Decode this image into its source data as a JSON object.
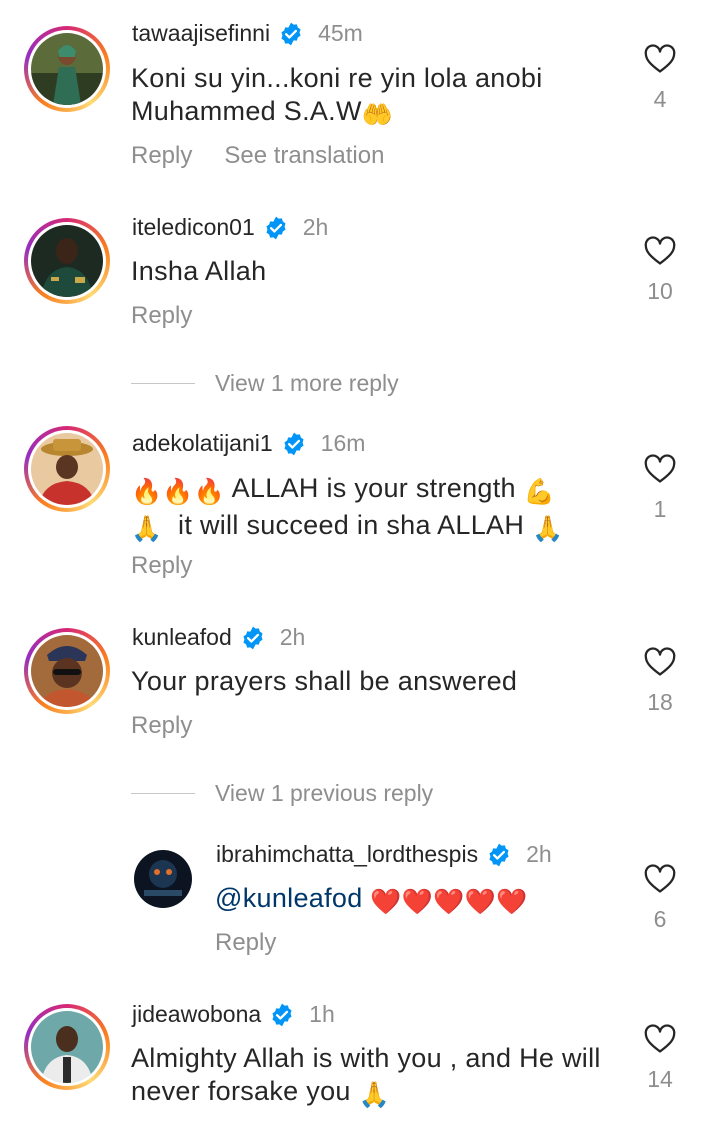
{
  "comments": [
    {
      "username": "tawaajisefinni",
      "time": "45m",
      "text_line1": "Koni su yin...koni re yin lola anobi",
      "text_line2": "Muhammed S.A.W",
      "text_line2_emoji": "🤲",
      "reply_label": "Reply",
      "translate_label": "See translation",
      "likes": "4"
    },
    {
      "username": "iteledicon01",
      "time": "2h",
      "text": "Insha Allah",
      "reply_label": "Reply",
      "likes": "10"
    },
    {
      "username": "adekolatijani1",
      "time": "16m",
      "text_line1_emoji": "🔥🔥🔥",
      "text_line1": "ALLAH is your strength",
      "text_line1_end_emoji": "💪",
      "text_line2_emoji": "🙏",
      "text_line2": "it will succeed in sha ALLAH",
      "text_line2_end_emoji": "🙏",
      "reply_label": "Reply",
      "likes": "1"
    },
    {
      "username": "kunleafod",
      "time": "2h",
      "text": "Your prayers shall be answered",
      "reply_label": "Reply",
      "likes": "18"
    },
    {
      "username": "ibrahimchatta_lordthespis",
      "time": "2h",
      "mention": "@kunleafod",
      "text_emoji": "❤️❤️❤️❤️❤️",
      "reply_label": "Reply",
      "likes": "6"
    },
    {
      "username": "jideawobona",
      "time": "1h",
      "text_line1": "Almighty Allah is with you , and He will",
      "text_line2": "never forsake you",
      "text_line2_emoji": "🙏",
      "reply_label": "Reply",
      "likes": "14"
    }
  ],
  "view_more_reply": "View 1 more reply",
  "view_previous_reply": "View 1 previous reply",
  "colors": {
    "text": "#262626",
    "secondary": "#8e8e8e",
    "verified": "#0095f6",
    "mention": "#00376b"
  }
}
